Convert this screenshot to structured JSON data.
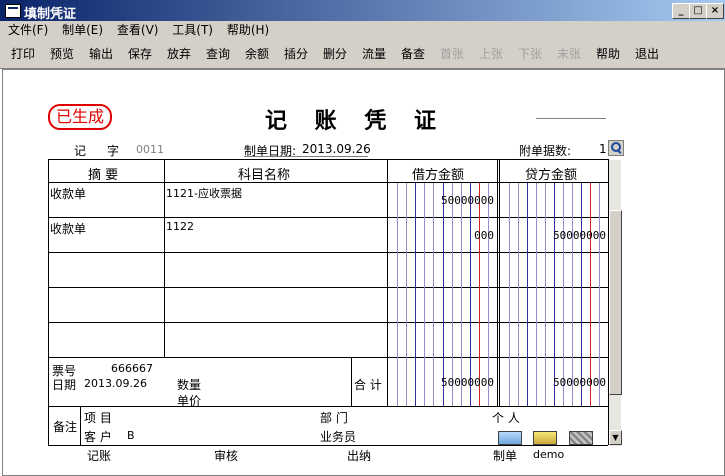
{
  "window": {
    "title": "填制凭证"
  },
  "menu": [
    "文件(F)",
    "制单(E)",
    "查看(V)",
    "工具(T)",
    "帮助(H)"
  ],
  "toolbar": [
    {
      "label": "打印",
      "enabled": true
    },
    {
      "label": "预览",
      "enabled": true
    },
    {
      "label": "输出",
      "enabled": true
    },
    {
      "label": "保存",
      "enabled": true
    },
    {
      "label": "放弃",
      "enabled": true
    },
    {
      "label": "查询",
      "enabled": true
    },
    {
      "label": "余额",
      "enabled": true
    },
    {
      "label": "插分",
      "enabled": true
    },
    {
      "label": "删分",
      "enabled": true
    },
    {
      "label": "流量",
      "enabled": true
    },
    {
      "label": "备查",
      "enabled": true
    },
    {
      "label": "首张",
      "enabled": false
    },
    {
      "label": "上张",
      "enabled": false
    },
    {
      "label": "下张",
      "enabled": false
    },
    {
      "label": "末张",
      "enabled": false
    },
    {
      "label": "帮助",
      "enabled": true
    },
    {
      "label": "退出",
      "enabled": true
    }
  ],
  "voucher": {
    "status_stamp": "已生成",
    "title": "记 账 凭 证",
    "type_label": "记",
    "zi_label": "字",
    "number": "0011",
    "date_label": "制单日期:",
    "date": "2013.09.26",
    "attachments_label": "附单据数:",
    "attachments": "1",
    "headers": {
      "summary": "摘 要",
      "account": "科目名称",
      "debit": "借方金额",
      "credit": "贷方金额"
    },
    "rows": [
      {
        "summary": "收款单",
        "account": "1121-应收票据",
        "debit": "50000000",
        "credit": ""
      },
      {
        "summary": "收款单",
        "account": "1122",
        "debit": "000",
        "credit": "50000000"
      },
      {
        "summary": "",
        "account": "",
        "debit": "",
        "credit": ""
      },
      {
        "summary": "",
        "account": "",
        "debit": "",
        "credit": ""
      },
      {
        "summary": "",
        "account": "",
        "debit": "",
        "credit": ""
      }
    ],
    "footer": {
      "ticket_label": "票号",
      "ticket_no": "666667",
      "date_label": "日期",
      "date": "2013.09.26",
      "qty_label": "数量",
      "price_label": "单价",
      "total_label": "合 计",
      "total_debit": "50000000",
      "total_credit": "50000000"
    },
    "remarks": {
      "label": "备注",
      "project_label": "项 目",
      "customer_label": "客 户",
      "customer": "B",
      "dept_label": "部 门",
      "person_label": "个 人",
      "sales_label": "业务员"
    },
    "signatures": {
      "bookkeeping": "记账",
      "review": "审核",
      "cashier": "出纳",
      "maker_label": "制单",
      "maker": "demo"
    }
  }
}
